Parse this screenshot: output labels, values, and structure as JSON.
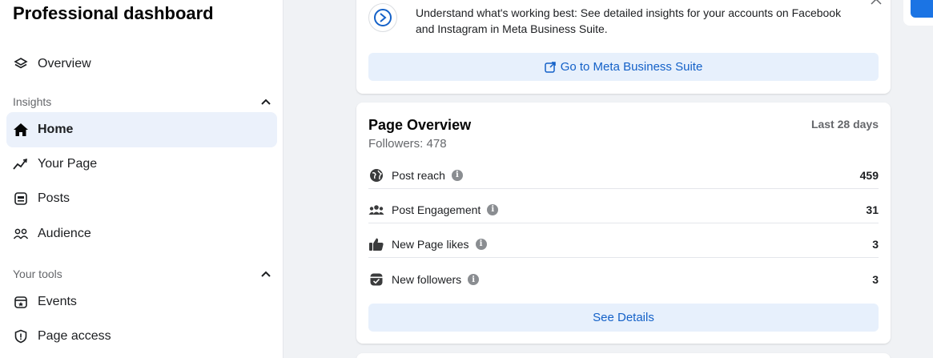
{
  "sidebar": {
    "title": "Professional dashboard",
    "overview_label": "Overview",
    "insights_section": "Insights",
    "tools_section": "Your tools",
    "items": [
      {
        "label": "Home",
        "icon": "home-icon"
      },
      {
        "label": "Your Page",
        "icon": "trend-icon"
      },
      {
        "label": "Posts",
        "icon": "posts-icon"
      },
      {
        "label": "Audience",
        "icon": "audience-icon"
      }
    ],
    "tools": [
      {
        "label": "Events",
        "icon": "calendar-icon"
      },
      {
        "label": "Page access",
        "icon": "shield-icon"
      }
    ]
  },
  "promo": {
    "text": "Understand what's working best: See detailed insights for your accounts on Facebook and Instagram in Meta Business Suite.",
    "button_label": "Go to Meta Business Suite"
  },
  "overview": {
    "title": "Page Overview",
    "followers": "Followers: 478",
    "range": "Last 28 days",
    "metrics": [
      {
        "label": "Post reach",
        "value": "459",
        "icon": "globe-icon"
      },
      {
        "label": "Post Engagement",
        "value": "31",
        "icon": "people-icon"
      },
      {
        "label": "New Page likes",
        "value": "3",
        "icon": "thumbs-up-icon"
      },
      {
        "label": "New followers",
        "value": "3",
        "icon": "followers-icon"
      }
    ],
    "details_label": "See Details"
  },
  "colors": {
    "accent": "#1461c8",
    "active_bg": "#ebf1fb",
    "button_bg": "#e7f0fc",
    "page_bg": "#f0f2f5"
  }
}
